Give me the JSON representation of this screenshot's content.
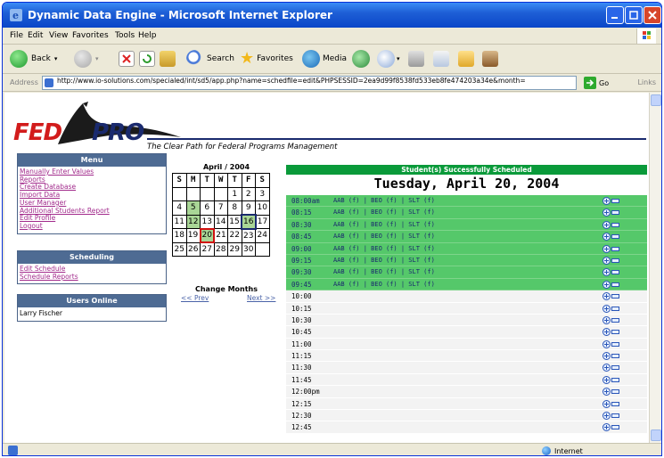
{
  "window": {
    "title": "Dynamic Data Engine - Microsoft Internet Explorer"
  },
  "menubar": {
    "items": [
      "File",
      "Edit",
      "View",
      "Favorites",
      "Tools",
      "Help"
    ]
  },
  "toolbar": {
    "back_label": "Back",
    "search_label": "Search",
    "favorites_label": "Favorites",
    "media_label": "Media"
  },
  "address": {
    "label": "Address",
    "url": "http://www.io-solutions.com/specialed/int/sd5/app.php?name=schedfile=edit&PHPSESSID=2ea9d99f8538fd533eb8fe474203a34e&month=",
    "go_label": "Go",
    "links_label": "Links"
  },
  "status": {
    "zone": "Internet"
  },
  "header": {
    "logo_part1": "FED",
    "logo_part2": "PRO",
    "tagline": "The Clear Path for Federal Programs Management"
  },
  "menu_panel": {
    "title": "Menu",
    "links": [
      "Manually Enter Values",
      "Reports",
      "Create Database",
      "Import Data",
      "User Manager",
      "Additional Students Report",
      "Edit Profile",
      "Logout"
    ]
  },
  "scheduling_panel": {
    "title": "Scheduling",
    "links": [
      "Edit Schedule",
      "Schedule Reports"
    ]
  },
  "users_panel": {
    "title": "Users Online",
    "users": [
      "Larry Fischer"
    ]
  },
  "calendar": {
    "title": "April / 2004",
    "weekdays": [
      "S",
      "M",
      "T",
      "W",
      "T",
      "F",
      "S"
    ],
    "weeks": [
      [
        "",
        "",
        "",
        "",
        "1",
        "2",
        "3"
      ],
      [
        "4",
        "5",
        "6",
        "7",
        "8",
        "9",
        "10"
      ],
      [
        "11",
        "12",
        "13",
        "14",
        "15",
        "16",
        "17"
      ],
      [
        "18",
        "19",
        "20",
        "21",
        "22",
        "23",
        "24"
      ],
      [
        "25",
        "26",
        "27",
        "28",
        "29",
        "30",
        ""
      ]
    ],
    "highlighted_days": [
      "5",
      "12",
      "16",
      "20"
    ],
    "today": "20",
    "selected": "16",
    "change_months_label": "Change Months",
    "prev_label": "<< Prev",
    "next_label": "Next >>"
  },
  "schedule": {
    "banner": "Student(s) Successfully Scheduled",
    "date_heading": "Tuesday, April 20, 2004",
    "slots": [
      {
        "time": "08:00am",
        "entries": "AAB (f) | BEO (f) | SLT (f)"
      },
      {
        "time": "08:15",
        "entries": "AAB (f) | BEO (f) | SLT (f)"
      },
      {
        "time": "08:30",
        "entries": "AAB (f) | BEO (f) | SLT (f)"
      },
      {
        "time": "08:45",
        "entries": "AAB (f) | BEO (f) | SLT (f)"
      },
      {
        "time": "09:00",
        "entries": "AAB (f) | BEO (f) | SLT (f)"
      },
      {
        "time": "09:15",
        "entries": "AAB (f) | BEO (f) | SLT (f)"
      },
      {
        "time": "09:30",
        "entries": "AAB (f) | BEO (f) | SLT (f)"
      },
      {
        "time": "09:45",
        "entries": "AAB (f) | BEO (f) | SLT (f)"
      },
      {
        "time": "10:00",
        "entries": ""
      },
      {
        "time": "10:15",
        "entries": ""
      },
      {
        "time": "10:30",
        "entries": ""
      },
      {
        "time": "10:45",
        "entries": ""
      },
      {
        "time": "11:00",
        "entries": ""
      },
      {
        "time": "11:15",
        "entries": ""
      },
      {
        "time": "11:30",
        "entries": ""
      },
      {
        "time": "11:45",
        "entries": ""
      },
      {
        "time": "12:00pm",
        "entries": ""
      },
      {
        "time": "12:15",
        "entries": ""
      },
      {
        "time": "12:30",
        "entries": ""
      },
      {
        "time": "12:45",
        "entries": ""
      }
    ]
  },
  "colors": {
    "booked": "#55c86a",
    "banner": "#0a9a3a",
    "link": "#a22b8c",
    "panel_header": "#4e6b93"
  }
}
